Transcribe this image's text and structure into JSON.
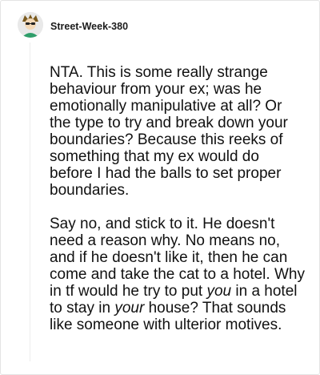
{
  "comment": {
    "author": "Street-Week-380",
    "paragraph1": "NTA. This is some really strange behaviour from your ex; was he emotionally manipulative at all? Or the type to try and break down your boundaries? Because this reeks of something that my ex would do before I had the balls to set proper boundaries.",
    "paragraph2": {
      "part1": "Say no, and stick to it. He doesn't need a reason why. No means no, and if he doesn't like it, then he can come and take the cat to a hotel. Why in tf would he try to put ",
      "em1": "you",
      "part2": " in a hotel to stay in ",
      "em2": "your",
      "part3": " house? That sounds like someone with ulterior motives."
    }
  },
  "avatar": {
    "icon": "user-avatar-icon",
    "colors": {
      "bg": "#e9e9e9",
      "hair": "#7a5a1e",
      "shirt": "#2f9e6a"
    }
  }
}
